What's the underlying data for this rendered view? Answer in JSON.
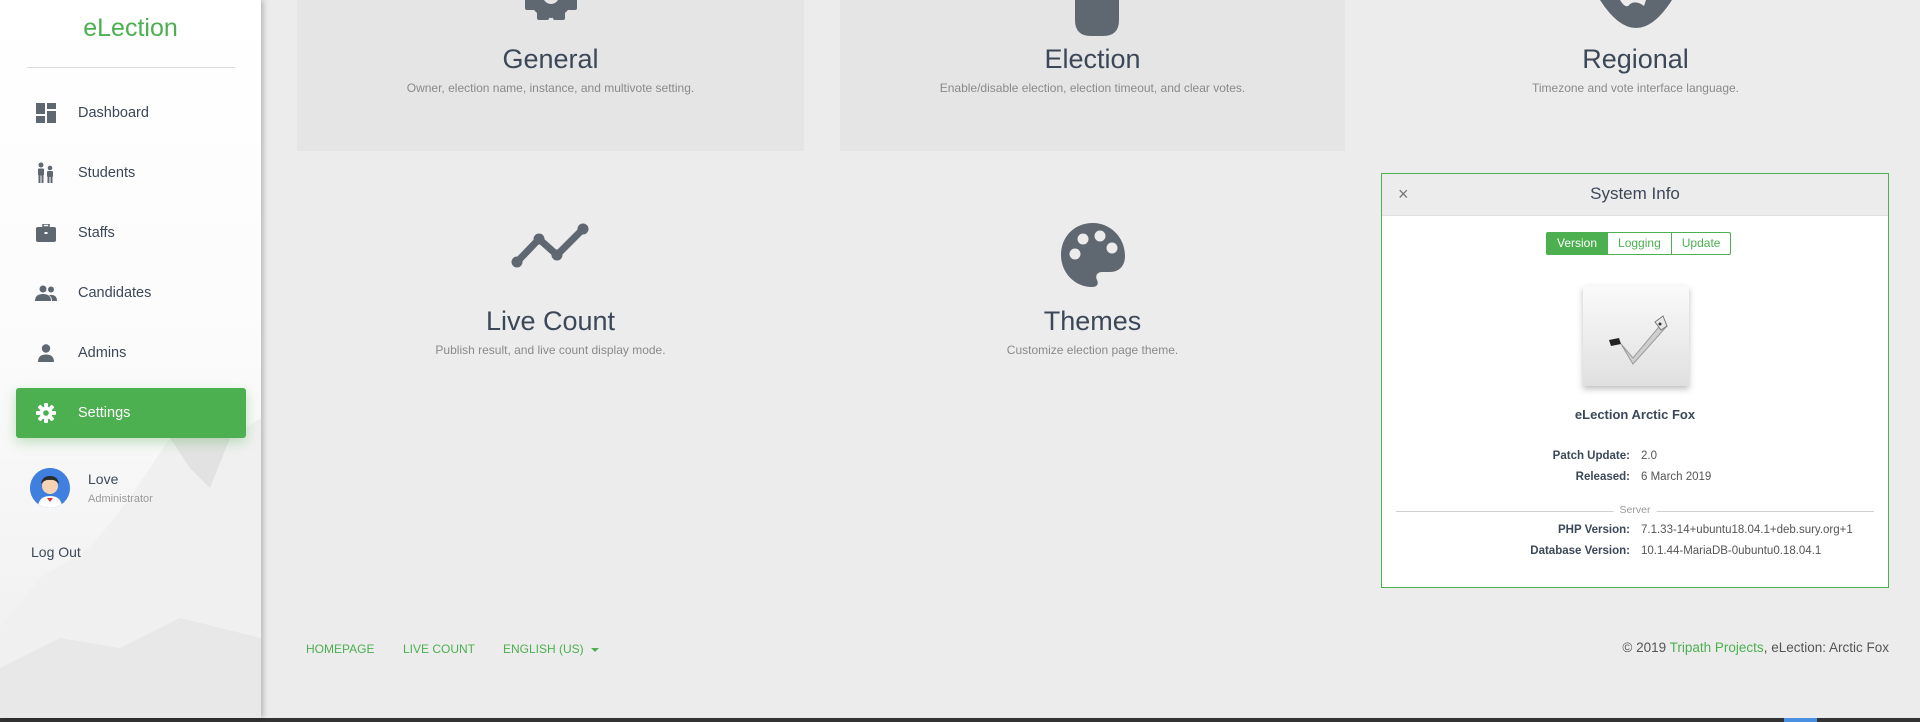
{
  "brand": "eLection",
  "sidebar": {
    "items": [
      {
        "label": "Dashboard",
        "icon": "dashboard-icon"
      },
      {
        "label": "Students",
        "icon": "students-icon"
      },
      {
        "label": "Staffs",
        "icon": "briefcase-icon"
      },
      {
        "label": "Candidates",
        "icon": "candidates-icon"
      },
      {
        "label": "Admins",
        "icon": "person-icon"
      },
      {
        "label": "Settings",
        "icon": "gear-icon",
        "active": true
      }
    ],
    "user": {
      "name": "Love",
      "role": "Administrator"
    },
    "logout": "Log Out"
  },
  "cards": [
    {
      "title": "General",
      "desc": "Owner, election name, instance, and multivote setting.",
      "icon": "gear-icon"
    },
    {
      "title": "Election",
      "desc": "Enable/disable election, election timeout, and clear votes.",
      "icon": "pointer-hand-icon"
    },
    {
      "title": "Regional",
      "desc": "Timezone and vote interface language.",
      "icon": "globe-icon"
    },
    {
      "title": "Live Count",
      "desc": "Publish result, and live count display mode.",
      "icon": "trending-line-icon"
    },
    {
      "title": "Themes",
      "desc": "Customize election page theme.",
      "icon": "palette-icon"
    }
  ],
  "system_info": {
    "title": "System Info",
    "close": "×",
    "tabs": [
      "Version",
      "Logging",
      "Update"
    ],
    "active_tab": "Version",
    "product": "eLection Arctic Fox",
    "patch_label": "Patch Update:",
    "patch_value": "2.0",
    "released_label": "Released:",
    "released_value": "6 March 2019",
    "section": "Server",
    "php_label": "PHP Version:",
    "php_value": "7.1.33-14+ubuntu18.04.1+deb.sury.org+1",
    "db_label": "Database Version:",
    "db_value": "10.1.44-MariaDB-0ubuntu0.18.04.1"
  },
  "footer": {
    "links": [
      "HOMEPAGE",
      "LIVE COUNT",
      "ENGLISH (US)"
    ],
    "copyright_prefix": "© 2019 ",
    "copyright_link": "Tripath Projects",
    "copyright_suffix": ", eLection: Arctic Fox"
  },
  "colors": {
    "accent": "#4caf50",
    "icon": "#5f6770",
    "text": "#3c4858"
  }
}
